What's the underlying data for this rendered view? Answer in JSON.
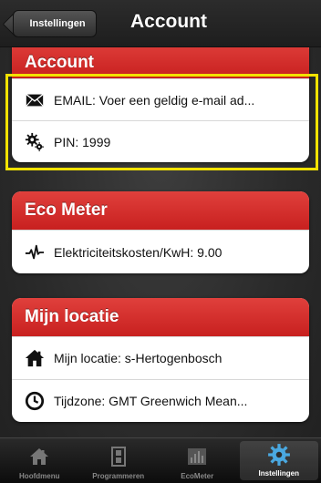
{
  "nav": {
    "back_label": "Instellingen",
    "title": "Account"
  },
  "sections": {
    "account": {
      "header": "Account",
      "rows": [
        {
          "icon": "envelope-icon",
          "label": "EMAIL: Voer een geldig e-mail ad..."
        },
        {
          "icon": "gears-icon",
          "label": "PIN: 1999"
        }
      ]
    },
    "eco_meter": {
      "header": "Eco Meter",
      "rows": [
        {
          "icon": "pulse-icon",
          "label": "Elektriciteitskosten/KwH: 9.00"
        }
      ]
    },
    "location": {
      "header": "Mijn locatie",
      "rows": [
        {
          "icon": "home-icon",
          "label": "Mijn locatie: s-Hertogenbosch"
        },
        {
          "icon": "clock-icon",
          "label": "Tijdzone: GMT   Greenwich Mean..."
        }
      ]
    }
  },
  "tabs": [
    {
      "label": "Hoofdmenu",
      "icon": "home-icon",
      "active": false
    },
    {
      "label": "Programmeren",
      "icon": "film-icon",
      "active": false
    },
    {
      "label": "EcoMeter",
      "icon": "bar-chart-icon",
      "active": false
    },
    {
      "label": "Instellingen",
      "icon": "gear-icon",
      "active": true
    }
  ],
  "colors": {
    "section_header": "#d22e2b",
    "highlight": "#f2e200",
    "active_tab_icon": "#4aa8e0"
  }
}
